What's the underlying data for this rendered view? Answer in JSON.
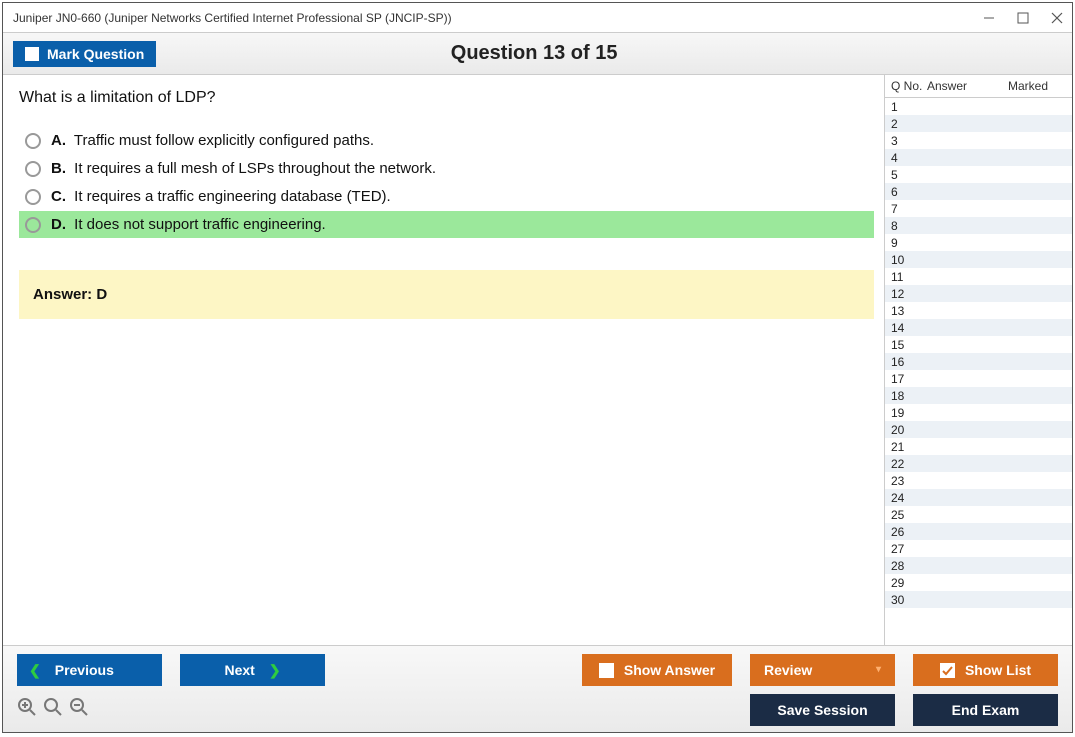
{
  "window": {
    "title": "Juniper JN0-660 (Juniper Networks Certified Internet Professional SP (JNCIP-SP))"
  },
  "header": {
    "mark_label": "Mark Question",
    "question_counter": "Question 13 of 15"
  },
  "question": {
    "text": "What is a limitation of LDP?",
    "options": [
      {
        "letter": "A.",
        "text": "Traffic must follow explicitly configured paths.",
        "highlight": false
      },
      {
        "letter": "B.",
        "text": "It requires a full mesh of LSPs throughout the network.",
        "highlight": false
      },
      {
        "letter": "C.",
        "text": "It requires a traffic engineering database (TED).",
        "highlight": false
      },
      {
        "letter": "D.",
        "text": "It does not support traffic engineering.",
        "highlight": true
      }
    ],
    "answer_label": "Answer: D"
  },
  "sidebar": {
    "headers": {
      "qno": "Q No.",
      "answer": "Answer",
      "marked": "Marked"
    },
    "rows": [
      {
        "q": "1"
      },
      {
        "q": "2"
      },
      {
        "q": "3"
      },
      {
        "q": "4"
      },
      {
        "q": "5"
      },
      {
        "q": "6"
      },
      {
        "q": "7"
      },
      {
        "q": "8"
      },
      {
        "q": "9"
      },
      {
        "q": "10"
      },
      {
        "q": "11"
      },
      {
        "q": "12"
      },
      {
        "q": "13"
      },
      {
        "q": "14"
      },
      {
        "q": "15"
      },
      {
        "q": "16"
      },
      {
        "q": "17"
      },
      {
        "q": "18"
      },
      {
        "q": "19"
      },
      {
        "q": "20"
      },
      {
        "q": "21"
      },
      {
        "q": "22"
      },
      {
        "q": "23"
      },
      {
        "q": "24"
      },
      {
        "q": "25"
      },
      {
        "q": "26"
      },
      {
        "q": "27"
      },
      {
        "q": "28"
      },
      {
        "q": "29"
      },
      {
        "q": "30"
      }
    ]
  },
  "footer": {
    "previous": "Previous",
    "next": "Next",
    "show_answer": "Show Answer",
    "review": "Review",
    "show_list": "Show List",
    "save_session": "Save Session",
    "end_exam": "End Exam"
  }
}
